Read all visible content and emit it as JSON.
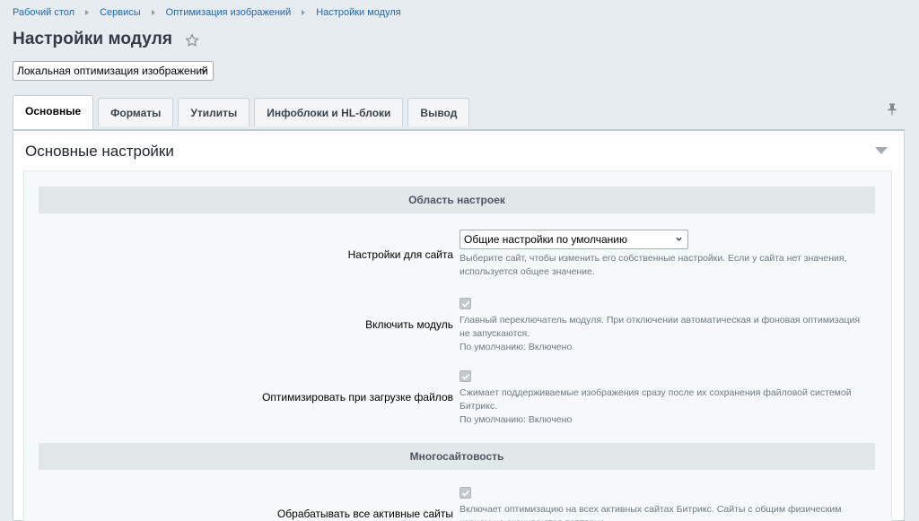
{
  "breadcrumb": [
    "Рабочий стол",
    "Сервисы",
    "Оптимизация изображений",
    "Настройки модуля"
  ],
  "page": {
    "title": "Настройки модуля"
  },
  "module_select": {
    "value": "Локальная оптимизация изображений"
  },
  "tabs": [
    {
      "label": "Основные",
      "active": true
    },
    {
      "label": "Форматы",
      "active": false
    },
    {
      "label": "Утилиты",
      "active": false
    },
    {
      "label": "Инфоблоки и HL-блоки",
      "active": false
    },
    {
      "label": "Вывод",
      "active": false
    }
  ],
  "section": {
    "title": "Основные настройки"
  },
  "groups": {
    "scope": "Область настроек",
    "multisite": "Многосайтовость"
  },
  "settings": {
    "site": {
      "label": "Настройки для сайта",
      "value": "Общие настройки по умолчанию",
      "hint": "Выберите сайт, чтобы изменить его собственные настройки. Если у сайта нет значения, используется общее значение."
    },
    "enable_module": {
      "label": "Включить модуль",
      "checked": true,
      "hint": "Главный переключатель модуля. При отключении автоматическая и фоновая оптимизация не запускаются.",
      "default": "По умолчанию: Включено"
    },
    "optimize_on_upload": {
      "label": "Оптимизировать при загрузке файлов",
      "checked": true,
      "hint": "Сжимает поддерживаемые изображения сразу после их сохранения файловой системой Битрикс.",
      "default": "По умолчанию: Включено"
    },
    "all_active_sites": {
      "label": "Обрабатывать все активные сайты",
      "checked": true,
      "hint": "Включает оптимизацию на всех активных сайтах Битрикс. Сайты с общим физическим корнем не скачиваются повторно."
    }
  },
  "colors": {
    "link": "#2067b0",
    "background": "#e6ecf0",
    "group_header": "#e0e8ea"
  }
}
